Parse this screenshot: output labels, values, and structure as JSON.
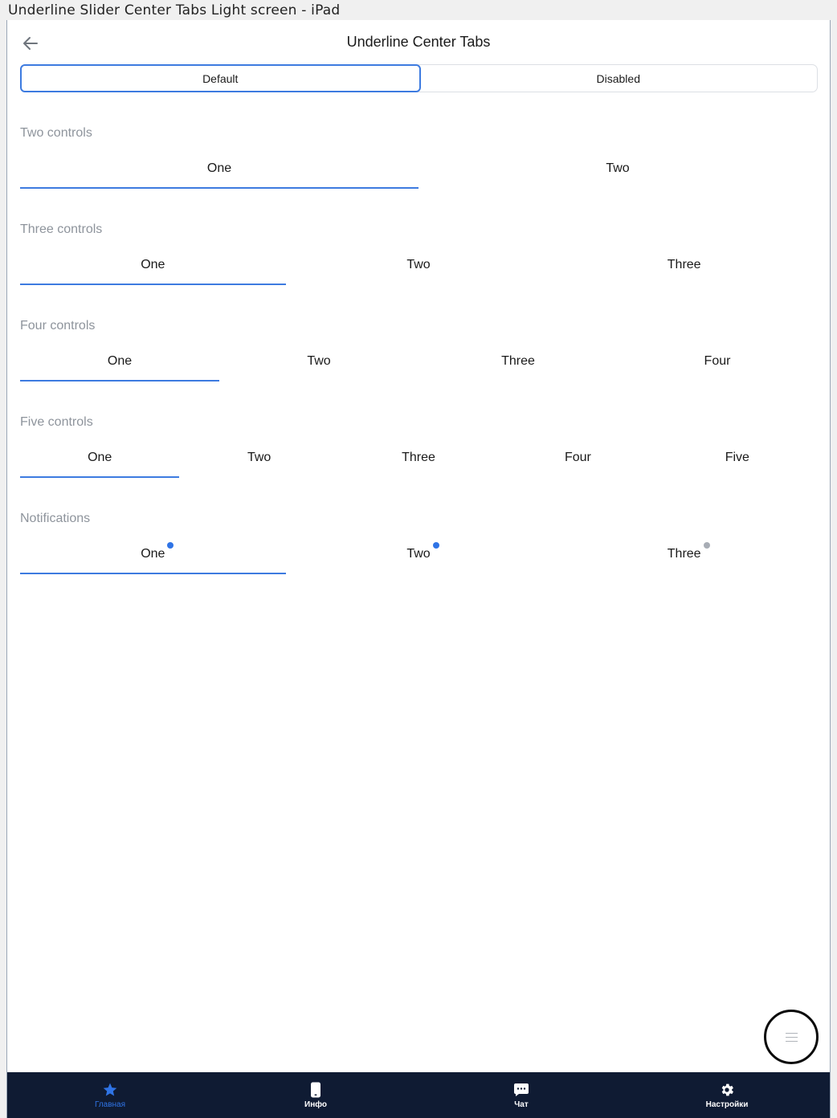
{
  "window": {
    "title": "Underline Slider Center Tabs Light screen - iPad"
  },
  "header": {
    "title": "Underline Center Tabs",
    "back_icon": "arrow-left-icon"
  },
  "segmented": {
    "options": [
      "Default",
      "Disabled"
    ],
    "selected": "Default"
  },
  "sections": [
    {
      "label": "Two controls",
      "tabs": [
        "One",
        "Two"
      ],
      "active": 0
    },
    {
      "label": "Three controls",
      "tabs": [
        "One",
        "Two",
        "Three"
      ],
      "active": 0
    },
    {
      "label": "Four controls",
      "tabs": [
        "One",
        "Two",
        "Three",
        "Four"
      ],
      "active": 0
    },
    {
      "label": "Five controls",
      "tabs": [
        "One",
        "Two",
        "Three",
        "Four",
        "Five"
      ],
      "active": 0
    },
    {
      "label": "Notifications",
      "tabs": [
        "One",
        "Two",
        "Three"
      ],
      "active": 0,
      "dots": [
        "blue",
        "blue",
        "gray"
      ]
    }
  ],
  "fab": {
    "icon": "menu-lines-icon"
  },
  "bottom_nav": {
    "items": [
      {
        "label": "Главная",
        "icon": "star-icon",
        "active": true
      },
      {
        "label": "Инфо",
        "icon": "phone-icon",
        "active": false
      },
      {
        "label": "Чат",
        "icon": "chat-icon",
        "active": false
      },
      {
        "label": "Настройки",
        "icon": "gear-icon",
        "active": false
      }
    ]
  },
  "colors": {
    "accent": "#3d7be0",
    "nav_bg": "#0f1b33",
    "section_label": "#8e949c",
    "dot_gray": "#a8adb5"
  }
}
